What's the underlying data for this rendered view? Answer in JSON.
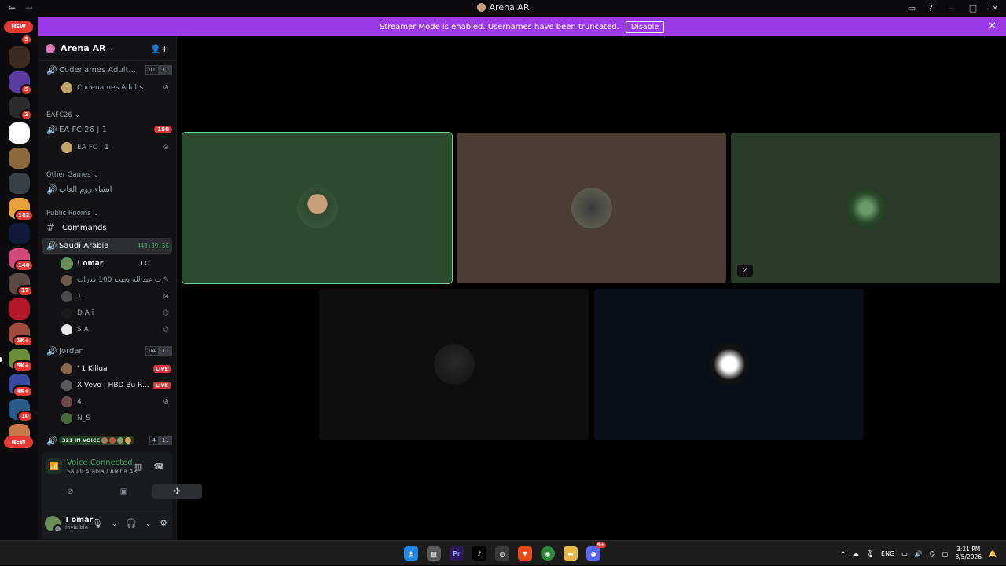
{
  "window": {
    "title": "Arena AR"
  },
  "banner": {
    "message": "Streamer Mode is enabled. Usernames have been truncated.",
    "disable_label": "Disable"
  },
  "rail": {
    "new_label": "NEW",
    "badges": [
      "5",
      "5",
      "2",
      "182",
      "140",
      "17",
      "1K+",
      "5K+",
      "4K+",
      "10"
    ]
  },
  "guild": {
    "name": "Arena AR"
  },
  "channels": {
    "codenames": {
      "name": "Codenames Adult...",
      "count_a": "01",
      "count_b": "11",
      "user": "Codenames Adults"
    },
    "cat_eafc": "EAFC26",
    "eafc": {
      "name": "EA FC 26 | 1",
      "count": "150",
      "user": "EA FC | 1"
    },
    "cat_other": "Other Games",
    "arabic": {
      "name": "انشاء روم العاب"
    },
    "cat_public": "Public Rooms",
    "commands": {
      "name": "Commands"
    },
    "saudi": {
      "name": "Saudi Arabia",
      "timer": "443:39:56"
    },
    "saudi_users": [
      "! omar",
      "يارب عبدالله يجيب 100 فدرات !",
      "1.",
      "D A i",
      "S A"
    ],
    "omar_tag": "LC",
    "jordan": {
      "name": "Jordan",
      "count_a": "04",
      "count_b": "11"
    },
    "jordan_users": [
      "' 1 Killua",
      "Ⅹ Vevo | HBD Bu R...",
      "4.",
      "N_S"
    ],
    "live_label": "LIVE",
    "invoice": {
      "label": "321 IN VOICE",
      "count_a": "4",
      "count_b": "11"
    }
  },
  "voice": {
    "status": "Voice Connected",
    "location": "Saudi Arabia / Arena AR"
  },
  "user": {
    "name": "! omar",
    "status": "Invisible"
  },
  "taskbar": {
    "lang": "ENG",
    "time": "3:21 PM",
    "date": "8/5/2026",
    "apps": [
      "Pr",
      "9+"
    ]
  },
  "colors": {
    "accent_banner": "#9b3ae8",
    "voice_green": "#3ba55d",
    "live_red": "#da373c"
  }
}
